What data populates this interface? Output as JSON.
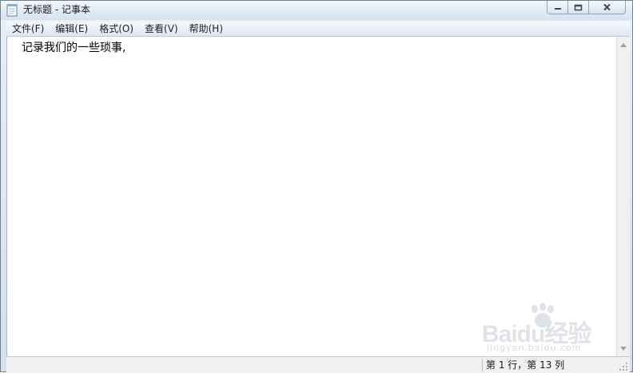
{
  "window": {
    "title": "无标题 - 记事本",
    "icon": "notepad-icon"
  },
  "caption_buttons": {
    "minimize": "minimize-icon",
    "maximize": "maximize-icon",
    "close": "close-icon"
  },
  "menu": {
    "items": [
      {
        "label": "文件(F)"
      },
      {
        "label": "编辑(E)"
      },
      {
        "label": "格式(O)"
      },
      {
        "label": "查看(V)"
      },
      {
        "label": "帮助(H)"
      }
    ]
  },
  "editor": {
    "content": "记录我们的一些琐事,"
  },
  "statusbar": {
    "position": "第 1 行，第 13 列"
  },
  "watermark": {
    "brand": "Baidu经验",
    "url": "jingyan.baidu.com"
  },
  "colors": {
    "menubar_bg": "#dfe7f2",
    "editor_bg": "#ffffff",
    "statusbar_bg": "#f0f0f0"
  }
}
